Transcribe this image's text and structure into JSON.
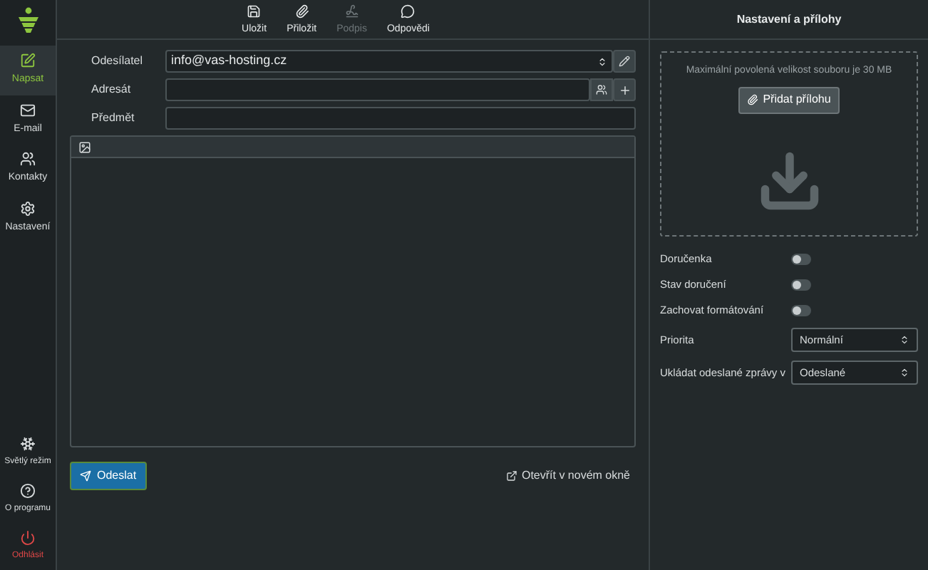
{
  "sidebar": {
    "items": [
      {
        "label": "Napsat",
        "selected": true
      },
      {
        "label": "E-mail",
        "selected": false
      },
      {
        "label": "Kontakty",
        "selected": false
      },
      {
        "label": "Nastavení",
        "selected": false
      }
    ],
    "bottom_items": [
      {
        "label": "Světlý režim",
        "kind": "normal"
      },
      {
        "label": "O programu",
        "kind": "normal"
      },
      {
        "label": "Odhlásit",
        "kind": "danger"
      }
    ]
  },
  "toolbar": [
    {
      "label": "Uložit",
      "disabled": false
    },
    {
      "label": "Přiložit",
      "disabled": false
    },
    {
      "label": "Podpis",
      "disabled": true
    },
    {
      "label": "Odpovědi",
      "disabled": false
    }
  ],
  "form": {
    "sender": {
      "label": "Odesílatel",
      "value": "info@vas-hosting.cz"
    },
    "recipient": {
      "label": "Adresát"
    },
    "subject": {
      "label": "Předmět"
    }
  },
  "send_button": "Odeslat",
  "open_new_window": "Otevřít v novém okně",
  "settings_panel": {
    "title": "Nastavení a přílohy",
    "max_size_note": "Maximální povolená velikost souboru je 30 MB",
    "add_attachment": "Přidat přílohu",
    "toggles": [
      {
        "label": "Doručenka",
        "on": false
      },
      {
        "label": "Stav doručení",
        "on": false
      },
      {
        "label": "Zachovat formátování",
        "on": false
      }
    ],
    "selects": [
      {
        "label": "Priorita",
        "value": "Normální"
      },
      {
        "label": "Ukládat odeslané zprávy v",
        "value": "Odeslané"
      }
    ]
  }
}
